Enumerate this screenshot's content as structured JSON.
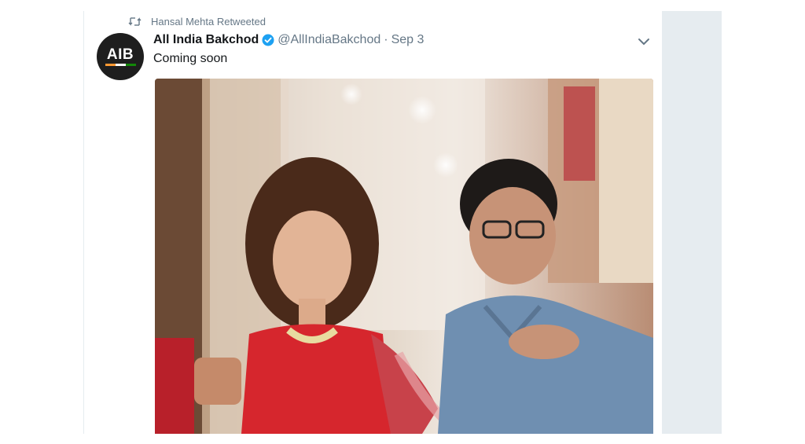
{
  "retweet": {
    "text": "Hansal Mehta Retweeted"
  },
  "author": {
    "avatar_text": "AIB",
    "display_name": "All India Bakchod",
    "handle": "@AllIndiaBakchod",
    "separator": "·",
    "date": "Sep 3"
  },
  "tweet": {
    "text": "Coming soon"
  },
  "icons": {
    "retweet": "retweet-icon",
    "verified": "verified-badge-icon",
    "menu": "chevron-down-icon"
  },
  "colors": {
    "verified_blue": "#1da1f2",
    "muted_text": "#657786",
    "primary_text": "#14171a",
    "side_panel": "#e6ecf0",
    "flag_saffron": "#ff9933",
    "flag_white": "#ffffff",
    "flag_green": "#138808"
  }
}
